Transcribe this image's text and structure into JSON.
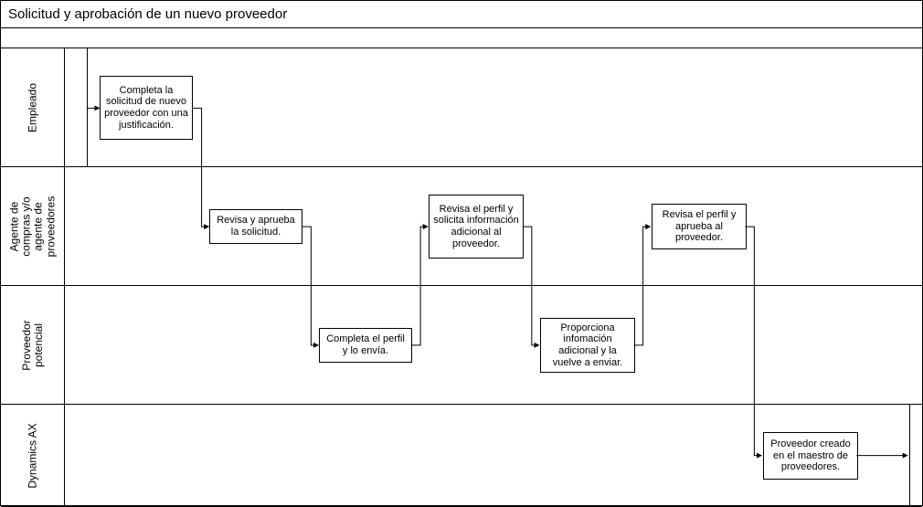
{
  "title": "Solicitud y aprobación de un nuevo proveedor",
  "lanes": {
    "empleado": {
      "label": "Empleado"
    },
    "agente": {
      "label": "Agente de\ncompras y/o\nagente de\nproveedores"
    },
    "proveedor": {
      "label": "Proveedor\npotencial"
    },
    "dynamics": {
      "label": "Dynamics AX"
    }
  },
  "tasks": {
    "t1": "Completa la solicitud de nuevo proveedor con una justificación.",
    "t2": "Revisa y aprueba la solicitud.",
    "t3": "Completa el perfil y lo envía.",
    "t4": "Revisa el perfil y solicita información adicional al proveedor.",
    "t5": "Proporciona infomación adicional y la vuelve a enviar.",
    "t6": "Revisa el perfil y aprueba al proveedor.",
    "t7": "Proveedor creado en el maestro de proveedores."
  },
  "chart_data": {
    "type": "swimlane-process",
    "title": "Solicitud y aprobación de un nuevo proveedor",
    "lanes": [
      "Empleado",
      "Agente de compras y/o agente de proveedores",
      "Proveedor potencial",
      "Dynamics AX"
    ],
    "steps": [
      {
        "id": "t1",
        "lane": "Empleado",
        "text": "Completa la solicitud de nuevo proveedor con una justificación."
      },
      {
        "id": "t2",
        "lane": "Agente de compras y/o agente de proveedores",
        "text": "Revisa y aprueba la solicitud."
      },
      {
        "id": "t3",
        "lane": "Proveedor potencial",
        "text": "Completa el perfil y lo envía."
      },
      {
        "id": "t4",
        "lane": "Agente de compras y/o agente de proveedores",
        "text": "Revisa el perfil y solicita información adicional al proveedor."
      },
      {
        "id": "t5",
        "lane": "Proveedor potencial",
        "text": "Proporciona infomación adicional y la vuelve a enviar."
      },
      {
        "id": "t6",
        "lane": "Agente de compras y/o agente de proveedores",
        "text": "Revisa el perfil y aprueba al proveedor."
      },
      {
        "id": "t7",
        "lane": "Dynamics AX",
        "text": "Proveedor creado en el maestro de proveedores."
      }
    ],
    "flows": [
      [
        "start",
        "t1"
      ],
      [
        "t1",
        "t2"
      ],
      [
        "t2",
        "t3"
      ],
      [
        "t3",
        "t4"
      ],
      [
        "t4",
        "t5"
      ],
      [
        "t5",
        "t6"
      ],
      [
        "t6",
        "t7"
      ],
      [
        "t7",
        "end"
      ]
    ]
  }
}
